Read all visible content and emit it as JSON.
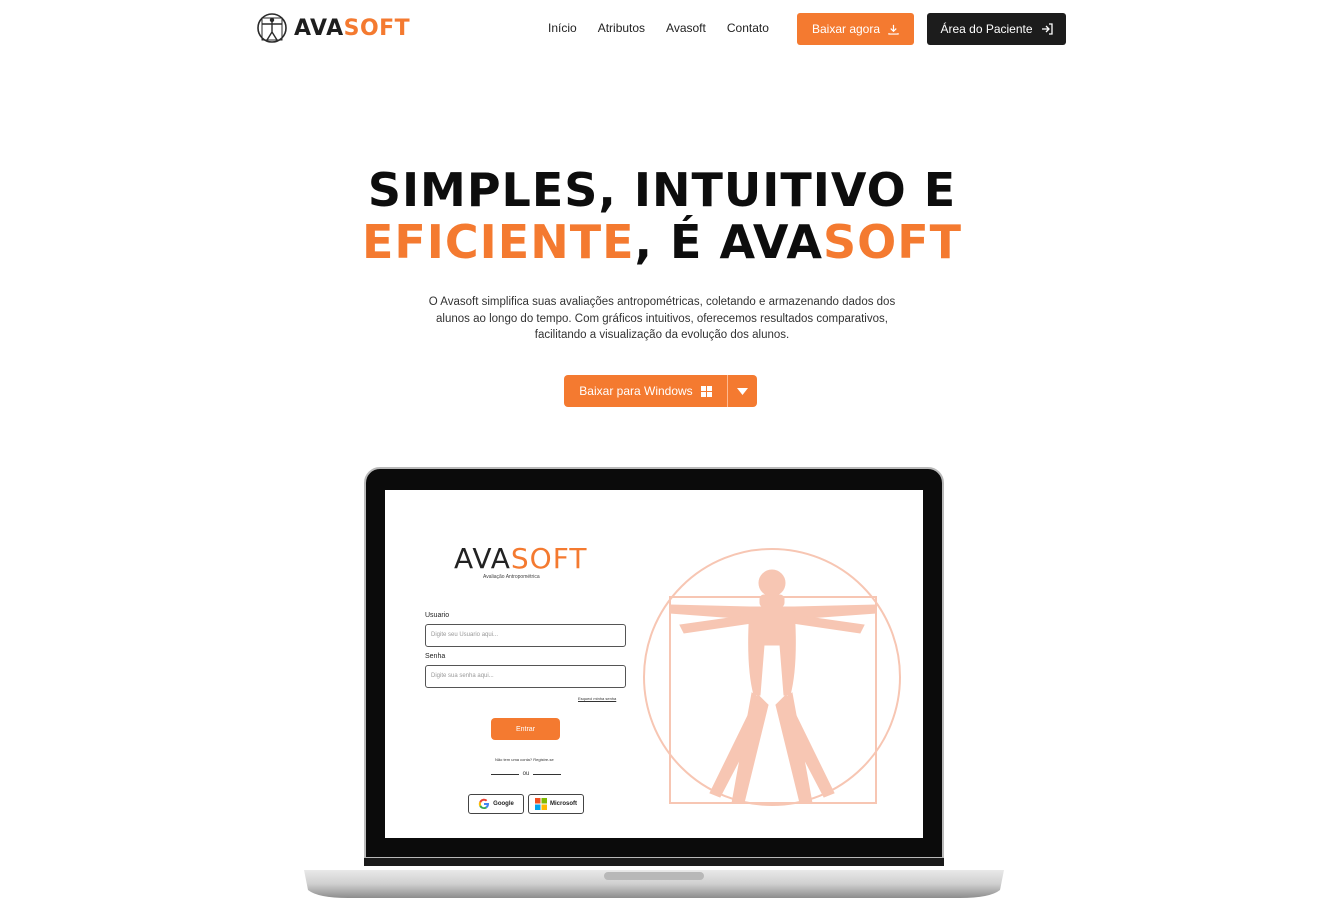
{
  "brand": {
    "part1": "AVA",
    "part2": "SOFT",
    "accent": "#f47a30",
    "dark": "#1c1c1c"
  },
  "nav": {
    "links": [
      "Início",
      "Atributos",
      "Avasoft",
      "Contato"
    ],
    "download_label": "Baixar agora",
    "download_icon": "download-icon",
    "patient_label": "Área do Paciente",
    "patient_icon": "login-icon"
  },
  "hero": {
    "line1": "SIMPLES, INTUITIVO E",
    "line2_accent": "EFICIENTE",
    "line2_middle": ", É AVA",
    "line2_end": "SOFT",
    "description": "O Avasoft simplifica suas avaliações antropométricas, coletando e armazenando dados dos alunos ao longo do tempo. Com gráficos intuitivos, oferecemos resultados comparativos, facilitando a visualização da evolução dos alunos.",
    "cta_label": "Baixar para Windows",
    "cta_icon": "windows-icon",
    "caret_icon": "caret-down-icon"
  },
  "screen": {
    "logo_part1": "AVA",
    "logo_part2": "SOFT",
    "subtitle": "Avaliação Antropométrica",
    "user_label": "Usuario",
    "user_placeholder": "Digite seu Usuario aqui...",
    "pass_label": "Senha",
    "pass_placeholder": "Digite sua senha aqui...",
    "forgot": "Esqueci minha senha",
    "enter": "Entrar",
    "signup": "Não tem uma conta? Registre-se",
    "or": "ou",
    "google": "Google",
    "microsoft": "Microsoft"
  }
}
